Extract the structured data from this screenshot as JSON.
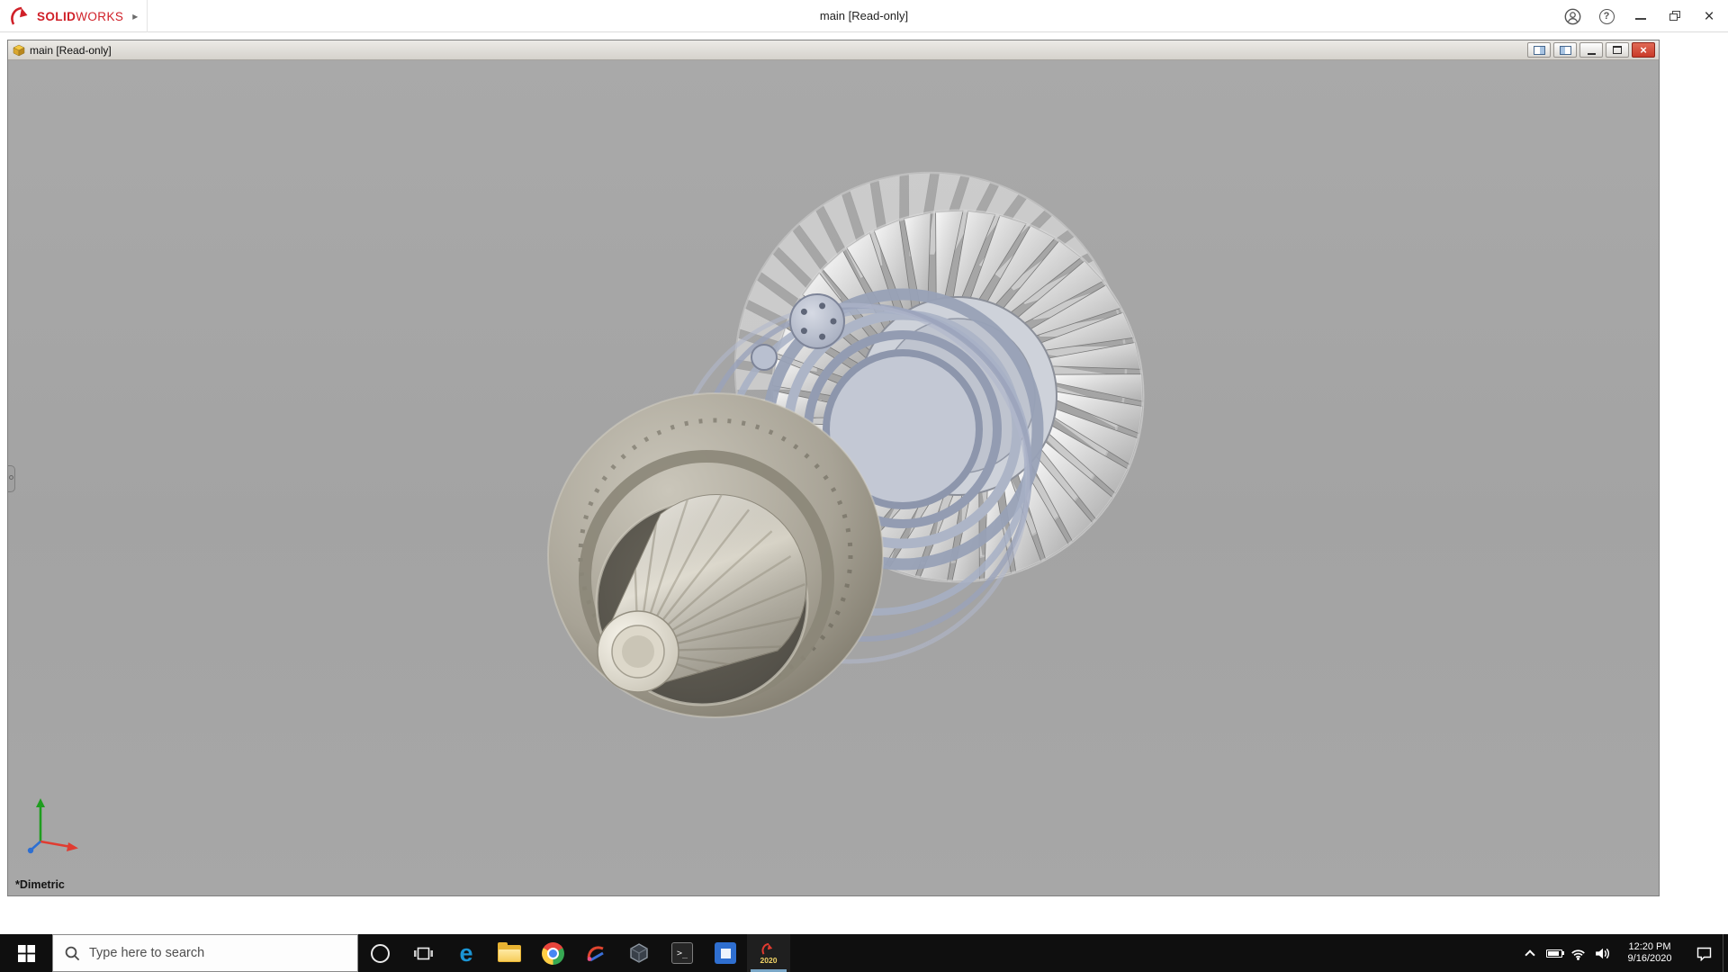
{
  "app": {
    "brand_bold": "SOLID",
    "brand_light": "WORKS",
    "title": "main [Read-only]",
    "menu_expand_glyph": "▸",
    "controls": {
      "help_glyph": "?",
      "close_glyph": "×"
    }
  },
  "document": {
    "title": "main [Read-only]",
    "view_orientation": "*Dimetric",
    "close_glyph": "×"
  },
  "taskbar": {
    "search_placeholder": "Type here to search",
    "edge_glyph": "e",
    "cmd_glyph": ">_",
    "solidworks_badge_year": "2020",
    "clock": {
      "time": "12:20 PM",
      "date": "9/16/2020"
    }
  },
  "colors": {
    "brand_red": "#d02028",
    "doc_close_red": "#c93a28",
    "viewport_gray": "#a4a4a4",
    "taskbar_bg": "#0f0f0f",
    "housing_blue_gray": "#a6afc4",
    "cowl_warm_gray": "#a8a396",
    "active_app_underline": "#7aa7c7"
  }
}
